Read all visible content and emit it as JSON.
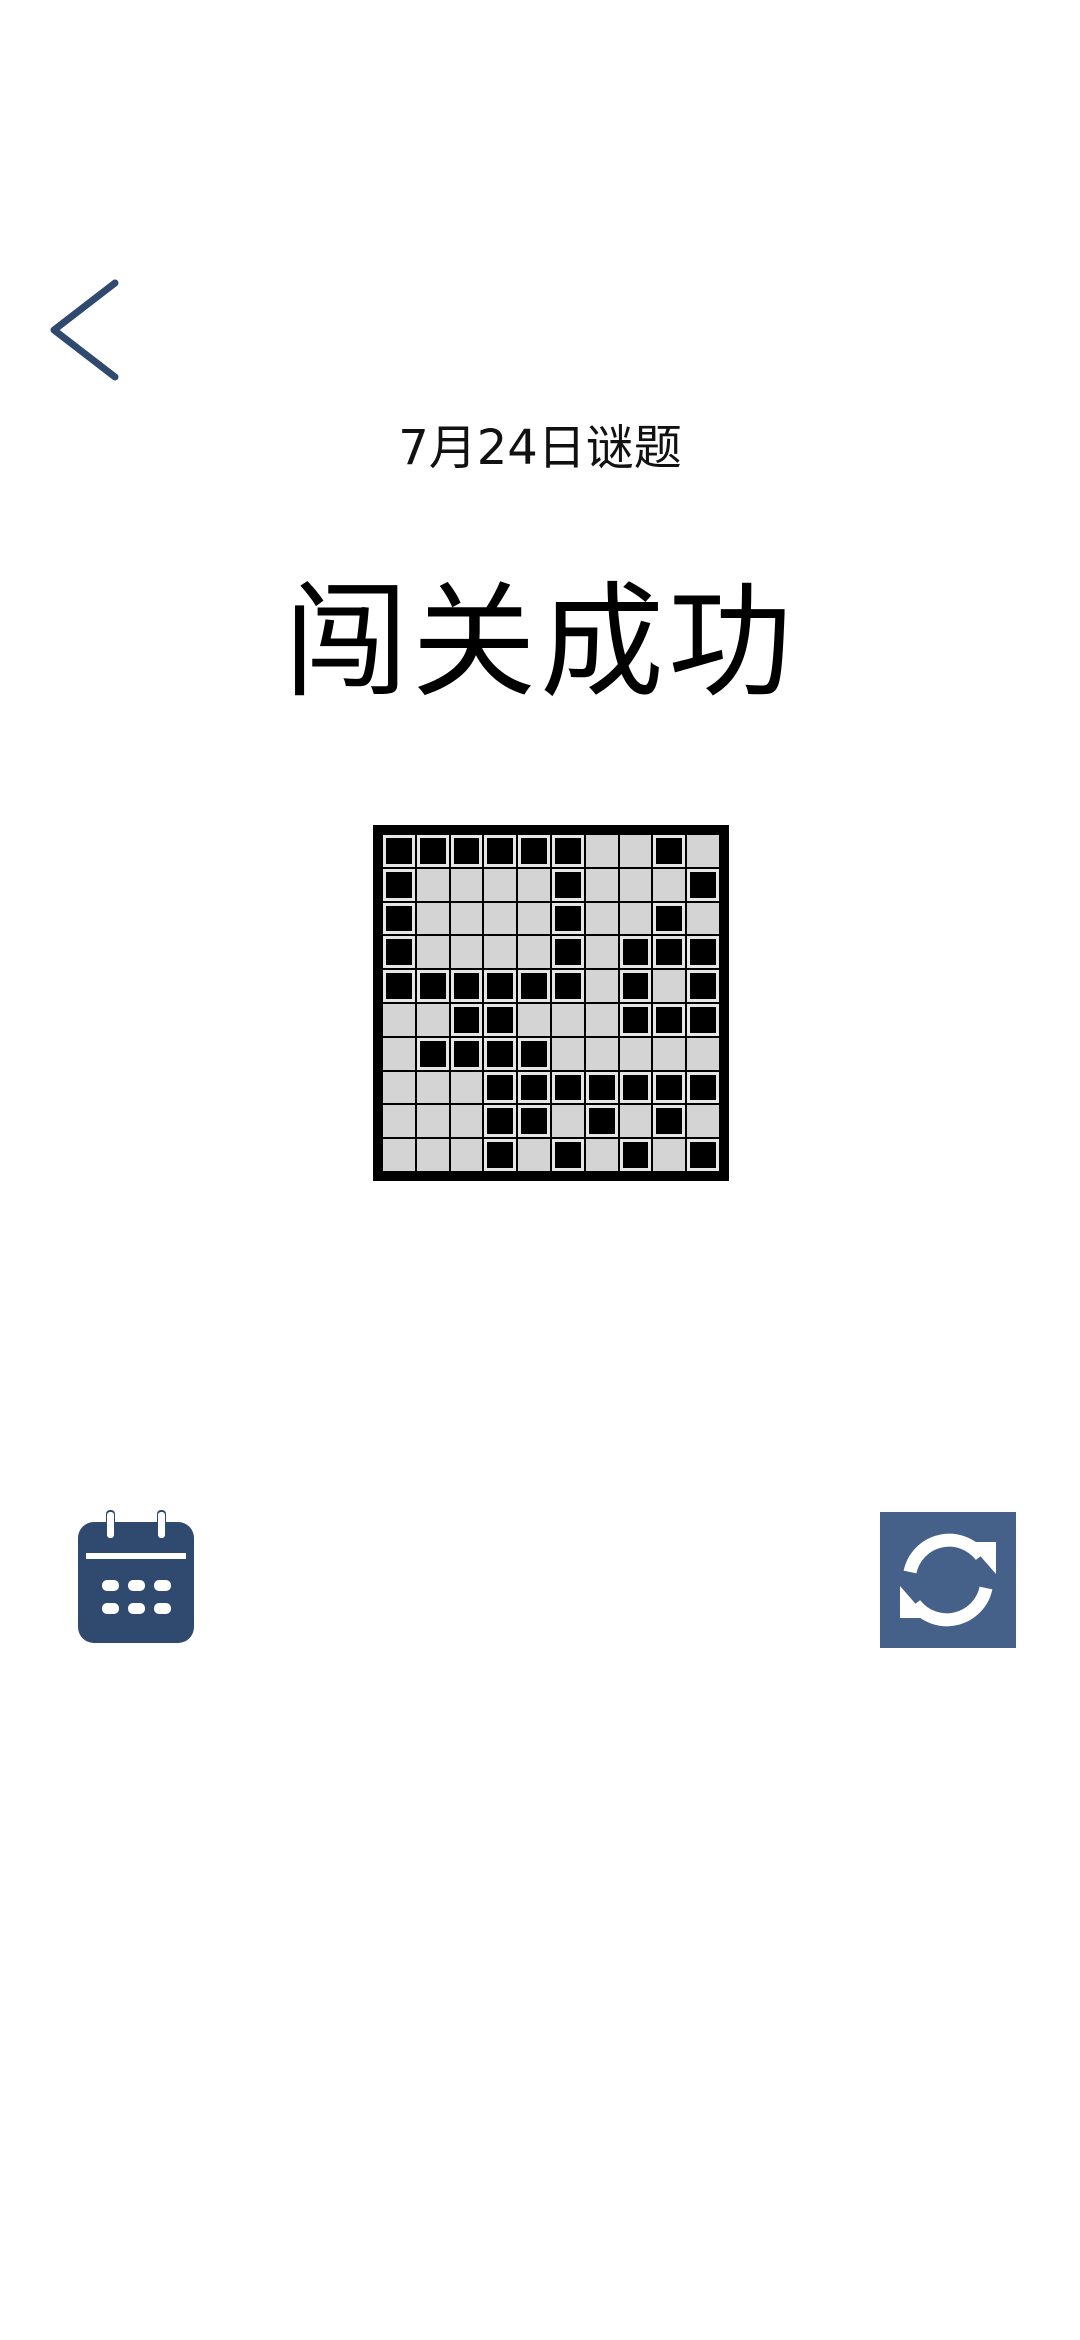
{
  "header": {
    "back_icon": "chevron-left-icon",
    "date_title": "7月24日谜题",
    "result_title": "闯关成功"
  },
  "puzzle": {
    "rows": 10,
    "cols": 10,
    "filled": [
      [
        1,
        1,
        1,
        1,
        1,
        1,
        0,
        0,
        1,
        0
      ],
      [
        1,
        0,
        0,
        0,
        0,
        1,
        0,
        0,
        0,
        1
      ],
      [
        1,
        0,
        0,
        0,
        0,
        1,
        0,
        0,
        1,
        0
      ],
      [
        1,
        0,
        0,
        0,
        0,
        1,
        0,
        1,
        1,
        1
      ],
      [
        1,
        1,
        1,
        1,
        1,
        1,
        0,
        1,
        0,
        1
      ],
      [
        0,
        0,
        1,
        1,
        0,
        0,
        0,
        1,
        1,
        1
      ],
      [
        0,
        1,
        1,
        1,
        1,
        0,
        0,
        0,
        0,
        0
      ],
      [
        0,
        0,
        0,
        1,
        1,
        1,
        1,
        1,
        1,
        1
      ],
      [
        0,
        0,
        0,
        1,
        1,
        0,
        1,
        0,
        1,
        0
      ],
      [
        0,
        0,
        0,
        1,
        0,
        1,
        0,
        1,
        0,
        1
      ]
    ]
  },
  "actions": {
    "calendar_icon": "calendar-icon",
    "refresh_icon": "refresh-icon"
  },
  "colors": {
    "accent": "#2f4a6e",
    "refresh_bg": "#45618a",
    "filled_cell": "#000000",
    "empty_cell": "#d4d4d4"
  }
}
